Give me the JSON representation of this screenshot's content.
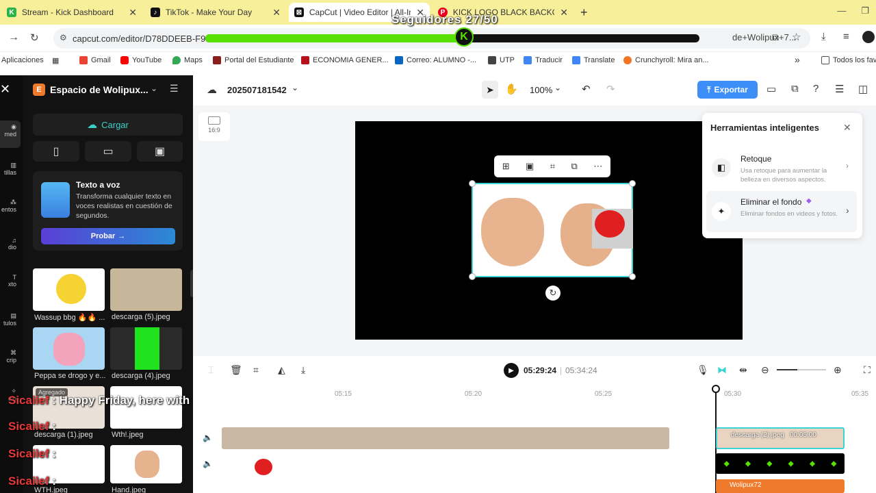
{
  "browser": {
    "tabs": [
      {
        "label": "Stream - Kick Dashboard",
        "favicon": "kick-icon",
        "color": "#2bb34a"
      },
      {
        "label": "TikTok - Make Your Day",
        "favicon": "tiktok-icon",
        "color": "#111111"
      },
      {
        "label": "CapCut | Video Editor | All-In-O",
        "favicon": "capcut-icon",
        "color": "#111111"
      },
      {
        "label": "KICK LOGO BLACK BACKGROUN",
        "favicon": "pinterest-icon",
        "color": "#e60023"
      }
    ],
    "new_tab": "+",
    "url": "capcut.com/editor/D78DDEEB-F95E",
    "url_tail": "de+Wolipux+7...",
    "stream_overlay": {
      "followers_label": "Seguidores 27/50",
      "progress": 0.54,
      "knob": "K"
    },
    "bookmarks": [
      {
        "label": "Aplicaciones",
        "icon": "apps-icon"
      },
      {
        "label": "Gmail",
        "icon": "gmail-icon"
      },
      {
        "label": "YouTube",
        "icon": "youtube-icon"
      },
      {
        "label": "Maps",
        "icon": "maps-icon"
      },
      {
        "label": "Portal del Estudiante",
        "icon": "portal-icon"
      },
      {
        "label": "ECONOMIA GENER...",
        "icon": "economia-icon"
      },
      {
        "label": "Correo: ALUMNO -...",
        "icon": "outlook-icon"
      },
      {
        "label": "UTP",
        "icon": "utp-icon"
      },
      {
        "label": "Traducir",
        "icon": "translate-icon"
      },
      {
        "label": "Translate",
        "icon": "translate-icon"
      },
      {
        "label": "Crunchyroll: Mira an...",
        "icon": "crunchyroll-icon"
      }
    ],
    "bookmarks_more": "»",
    "all_bookmarks": "Todos los fav"
  },
  "sidenav": [
    "med",
    "tillas",
    "entos",
    "dio",
    "xto",
    "tulos",
    "crip",
    "cto"
  ],
  "workspace": {
    "badge": "E",
    "title": "Espacio de Wolipux...",
    "upload": "Cargar",
    "tts": {
      "title": "Texto a voz",
      "desc": "Transforma cualquier texto en voces realistas en cuestión de segundos.",
      "button": "Probar"
    },
    "media": [
      {
        "label": "Wassup bbg 🔥🔥 ..."
      },
      {
        "label": "descarga (5).jpeg"
      },
      {
        "label": "Peppa se drogo y e..."
      },
      {
        "label": "descarga (4).jpeg"
      },
      {
        "label": "descarga (1).jpeg",
        "badge": "Agregado"
      },
      {
        "label": "Wth!.jpeg"
      },
      {
        "label": "WTH.jpeg"
      },
      {
        "label": "Hand.jpeg"
      }
    ]
  },
  "chat": [
    {
      "name": "Sicailef",
      "message": ": Happy Friday, here with the good vibes."
    },
    {
      "name": "Sicailef",
      "message": ":"
    },
    {
      "name": "Sicailef",
      "message": ":"
    },
    {
      "name": "Sicailef",
      "message": ":"
    }
  ],
  "editor": {
    "project_name": "202507181542",
    "zoom": "100%",
    "export": "Exportar",
    "ratio": "16:9",
    "smart_tools": {
      "title": "Herramientas inteligentes",
      "items": [
        {
          "title": "Retoque",
          "desc": "Usa retoque para aumentar la belleza en diversos aspectos."
        },
        {
          "title": "Eliminar el fondo",
          "desc": "Eliminar fondos en videos y fotos."
        }
      ]
    }
  },
  "timeline": {
    "current_time": "05:29:24",
    "total_time": "05:34:24",
    "ruler": [
      "05:15",
      "05:20",
      "05:25",
      "05:30",
      "05:35"
    ],
    "clip_label": "descarga (2).jpeg",
    "clip_duration": "00:05:00",
    "bottom_clip": "Wolipux72"
  }
}
